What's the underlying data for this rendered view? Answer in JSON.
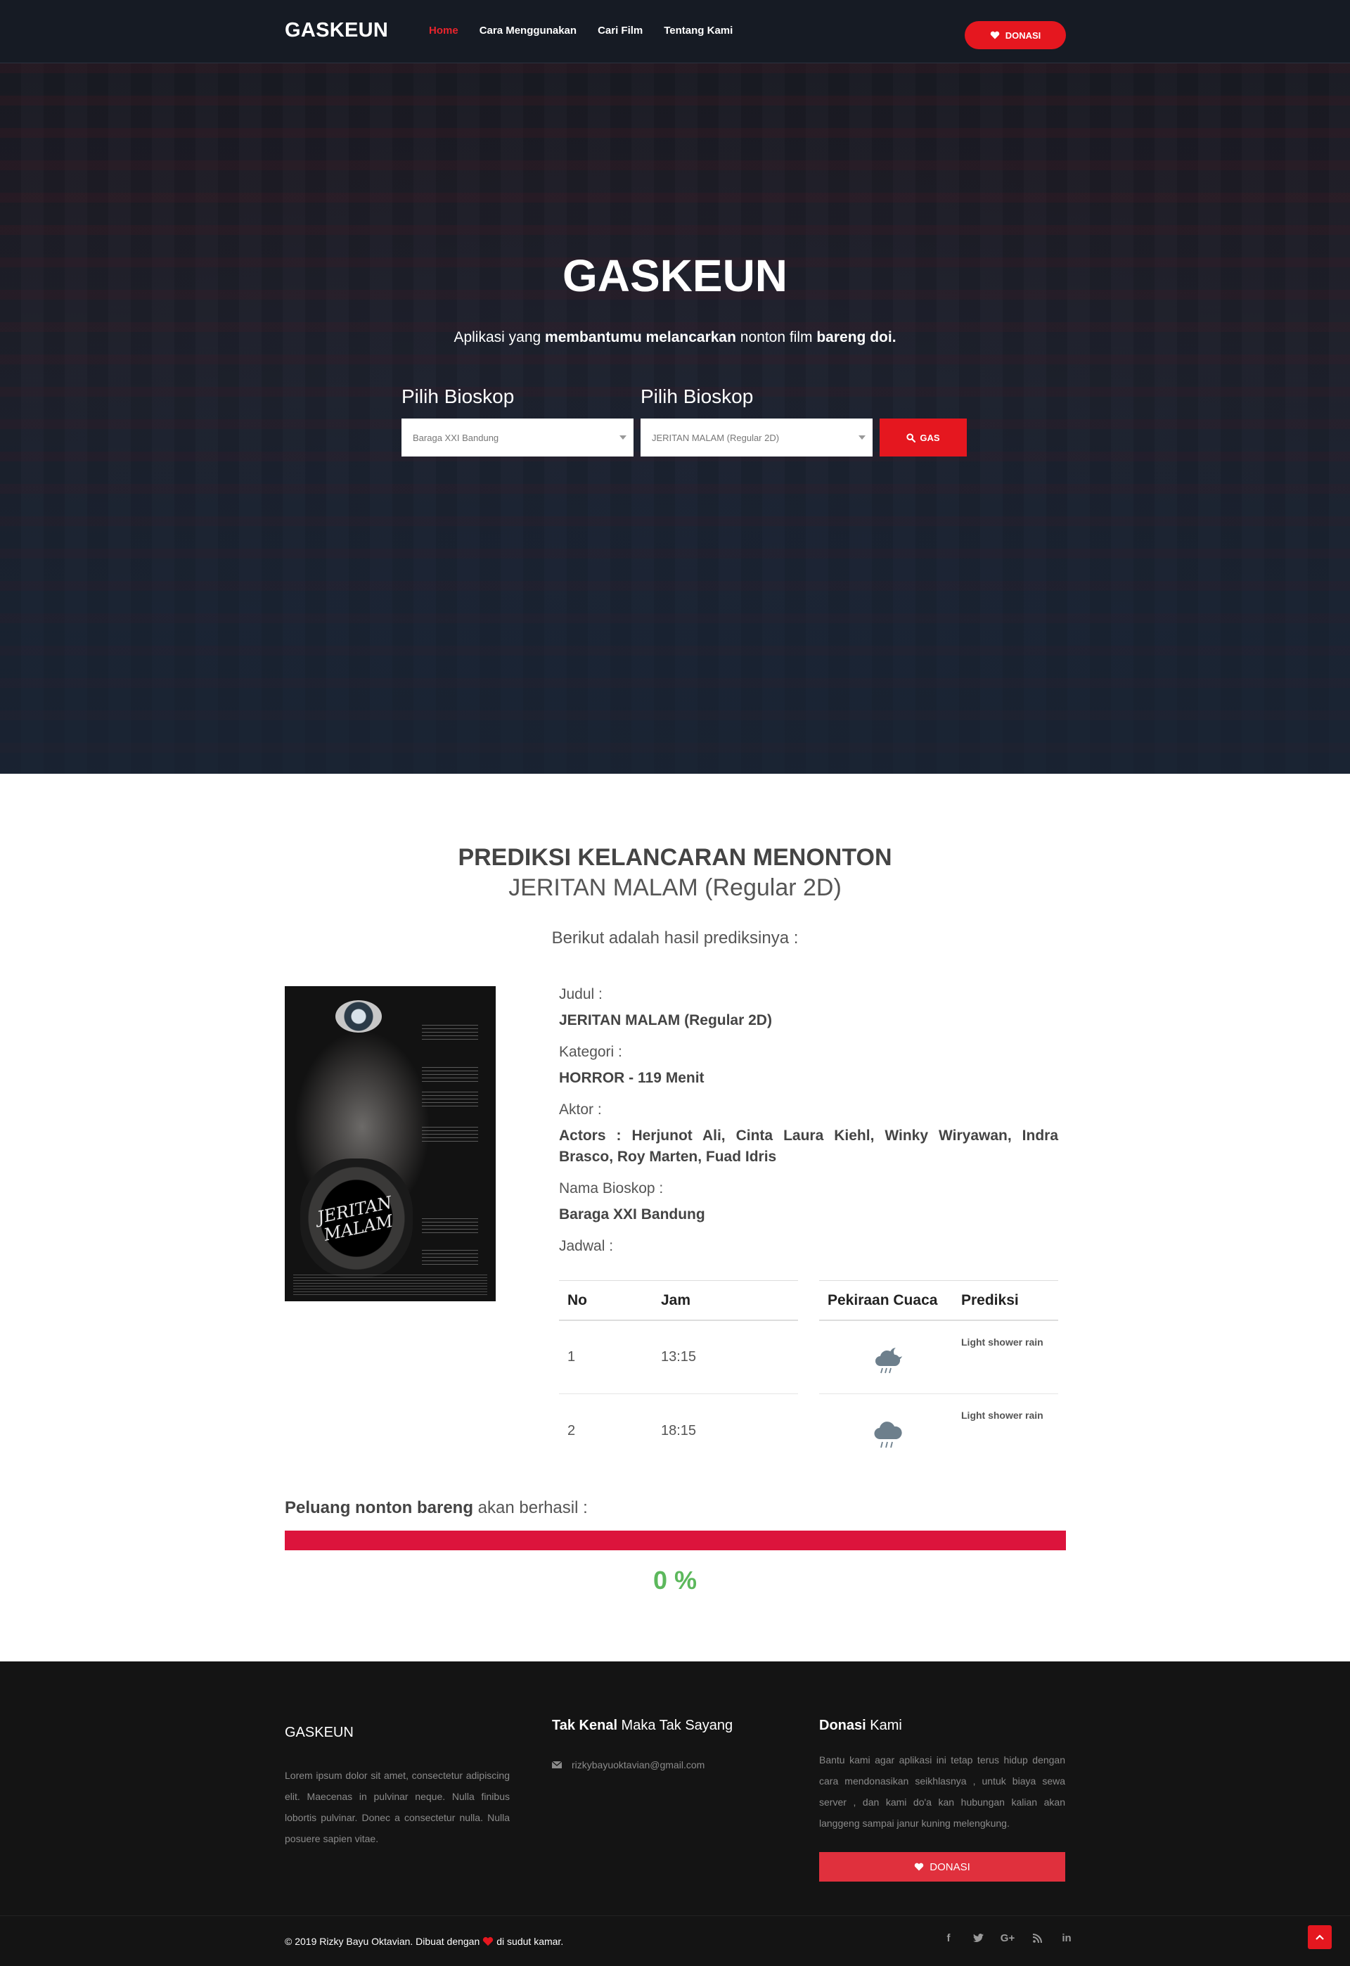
{
  "nav": {
    "brand": "GASKEUN",
    "links": [
      "Home",
      "Cara Menggunakan",
      "Cari Film",
      "Tentang Kami"
    ],
    "donasi_label": "DONASI"
  },
  "hero": {
    "title": "GASKEUN",
    "subtitle_1": "Aplikasi yang ",
    "subtitle_bold_1": "membantumu melancarkan",
    "subtitle_2": " nonton film ",
    "subtitle_bold_2": "bareng doi.",
    "select_1_label": "Pilih Bioskop",
    "select_1_value": "Baraga XXI Bandung",
    "select_2_label": "Pilih Bioskop",
    "select_2_value": "JERITAN MALAM (Regular 2D)",
    "button_label": "GAS"
  },
  "prediction": {
    "title": "PREDIKSI KELANCARAN MENONTON",
    "movie": "JERITAN MALAM (Regular 2D)",
    "intro": "Berikut adalah hasil prediksinya :",
    "poster_title": "JERITAN MALAM",
    "fields": {
      "judul_label": "Judul :",
      "judul_value": "JERITAN MALAM (Regular 2D)",
      "kategori_label": "Kategori :",
      "kategori_value": "HORROR - 119 Menit",
      "aktor_label": "Aktor :",
      "aktor_value": "Actors : Herjunot Ali, Cinta Laura Kiehl, Winky Wiryawan, Indra Brasco, Roy Marten, Fuad Idris",
      "bioskop_label": "Nama Bioskop :",
      "bioskop_value": "Baraga XXI Bandung",
      "jadwal_label": "Jadwal :"
    },
    "table": {
      "headers": [
        "No",
        "Jam",
        "Pekiraan Cuaca",
        "Prediksi"
      ],
      "rows": [
        {
          "no": "1",
          "jam": "13:15",
          "weather_icon": "night-shower-icon",
          "prediksi": "Light shower rain"
        },
        {
          "no": "2",
          "jam": "18:15",
          "weather_icon": "shower-rain-icon",
          "prediksi": "Light shower rain"
        }
      ]
    },
    "chance_bold": "Peluang nonton bareng",
    "chance_text": " akan berhasil :",
    "chance_value": 0,
    "chance_label": "0 %",
    "colors": {
      "bar": "#dc143c",
      "success": "#5cb85c",
      "accent": "#e5171f"
    }
  },
  "footer": {
    "col1_title": "GASKEUN",
    "col1_text": "Lorem ipsum dolor sit amet, consectetur adipiscing elit. Maecenas in pulvinar neque. Nulla finibus lobortis pulvinar. Donec a consectetur nulla. Nulla posuere sapien vitae.",
    "col2_title_bold": "Tak Kenal",
    "col2_title_rest": " Maka Tak Sayang",
    "email": "rizkybayuoktavian@gmail.com",
    "col3_title_bold": "Donasi",
    "col3_title_rest": " Kami",
    "col3_text": "Bantu kami agar aplikasi ini tetap terus hidup dengan cara mendonasikan seikhlasnya , untuk biaya sewa server , dan kami do'a kan hubungan kalian akan langgeng sampai janur kuning melengkung.",
    "donasi_label": "DONASI",
    "copyright_1": "© 2019 Rizky Bayu Oktavian. Dibuat dengan",
    "copyright_2": "di sudut kamar.",
    "socials": [
      "f",
      "t",
      "G+",
      "rss",
      "in"
    ]
  }
}
